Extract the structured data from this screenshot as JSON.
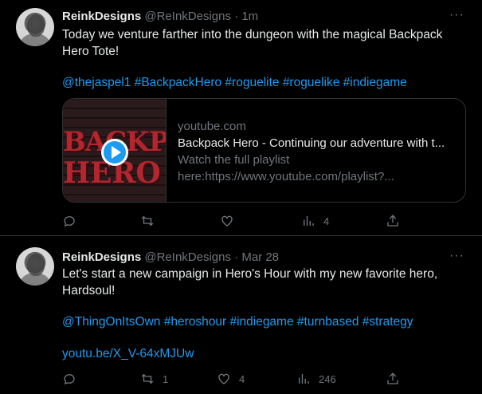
{
  "tweets": [
    {
      "display_name": "ReinkDesigns",
      "handle": "@ReInkDesigns",
      "separator": "·",
      "time": "1m",
      "more": "···",
      "text_line": "Today we venture farther into the dungeon with the magical Backpack Hero Tote!",
      "hashtags": "@thejaspel1 #BackpackHero #roguelite #roguelike #indiegame",
      "card": {
        "thumb_text_1": "BACKPACK",
        "thumb_text_2": "HERO",
        "domain": "youtube.com",
        "title": "Backpack Hero - Continuing our adventure with t...",
        "desc": "Watch the full playlist here:https://www.youtube.com/playlist?..."
      },
      "actions": {
        "reply": "",
        "retweet": "",
        "like": "",
        "views": "4",
        "share": ""
      }
    },
    {
      "display_name": "ReinkDesigns",
      "handle": "@ReInkDesigns",
      "separator": "·",
      "time": "Mar 28",
      "more": "···",
      "text_line": "Let's start a new campaign in Hero's Hour with my new favorite hero, Hardsoul!",
      "hashtags": "@ThingOnItsOwn #heroshour #indiegame #turnbased #strategy",
      "link": "youtu.be/X_V-64xMJUw",
      "actions": {
        "reply": "",
        "retweet": "1",
        "like": "4",
        "views": "246",
        "share": ""
      }
    }
  ]
}
